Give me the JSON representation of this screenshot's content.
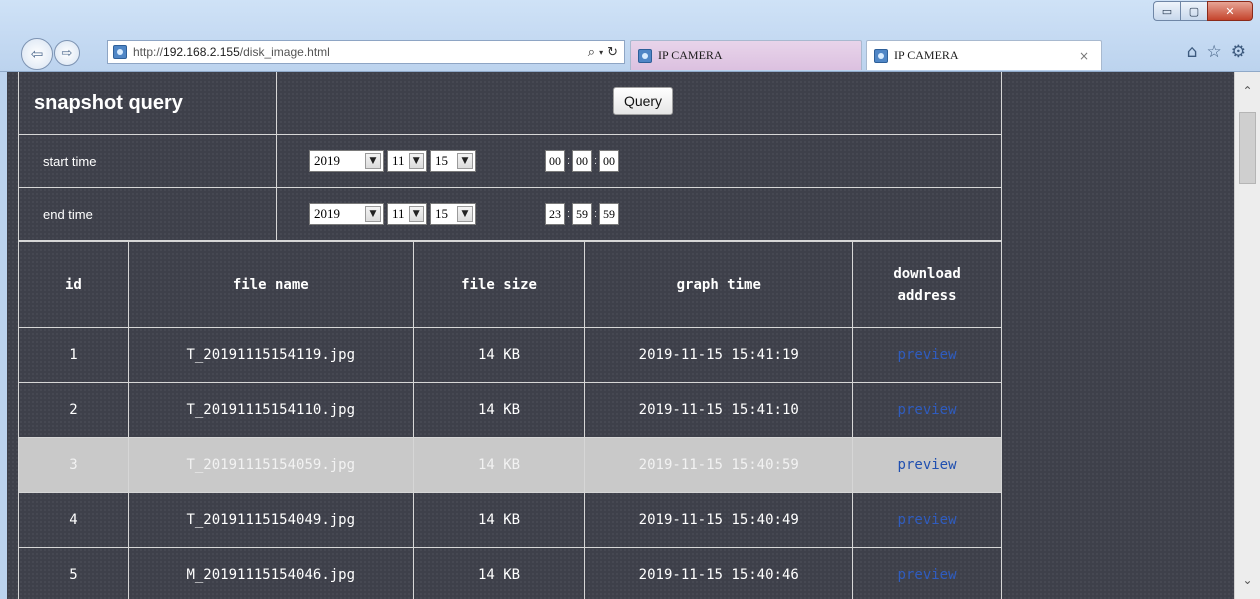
{
  "browser": {
    "url_prefix": "http://",
    "url_host": "192.168.2.155",
    "url_path": "/disk_image.html",
    "search_glyph": "⌕",
    "drop_glyph": "▾",
    "refresh_glyph": "↻",
    "back_glyph": "⇦",
    "forward_glyph": "⇨",
    "tabs": [
      {
        "title": "IP CAMERA"
      },
      {
        "title": "IP CAMERA",
        "close": "×"
      }
    ],
    "icons": {
      "home": "⌂",
      "favorites": "☆",
      "settings": "⚙"
    },
    "window_controls": {
      "minimize": "▭",
      "maximize": "▢",
      "close": "✕"
    }
  },
  "query": {
    "title": "snapshot query",
    "button_label": "Query",
    "start": {
      "label": "start time",
      "year": "2019",
      "month": "11",
      "day": "15",
      "hh": "00",
      "mm": "00",
      "ss": "00"
    },
    "end": {
      "label": "end time",
      "year": "2019",
      "month": "11",
      "day": "15",
      "hh": "23",
      "mm": "59",
      "ss": "59"
    },
    "dropdown_glyph": "▼",
    "time_separator": ":"
  },
  "table": {
    "headers": {
      "id": "id",
      "file_name": "file name",
      "file_size": "file size",
      "graph_time": "graph time",
      "download_line1": "download",
      "download_line2": "address"
    },
    "rows": [
      {
        "id": "1",
        "file_name": "T_20191115154119.jpg",
        "file_size": "14 KB",
        "graph_time": "2019-11-15 15:41:19",
        "link": "preview"
      },
      {
        "id": "2",
        "file_name": "T_20191115154110.jpg",
        "file_size": "14 KB",
        "graph_time": "2019-11-15 15:41:10",
        "link": "preview"
      },
      {
        "id": "3",
        "file_name": "T_20191115154059.jpg",
        "file_size": "14 KB",
        "graph_time": "2019-11-15 15:40:59",
        "link": "preview"
      },
      {
        "id": "4",
        "file_name": "T_20191115154049.jpg",
        "file_size": "14 KB",
        "graph_time": "2019-11-15 15:40:49",
        "link": "preview"
      },
      {
        "id": "5",
        "file_name": "M_20191115154046.jpg",
        "file_size": "14 KB",
        "graph_time": "2019-11-15 15:40:46",
        "link": "preview"
      }
    ]
  },
  "colors": {
    "page_background": "#3e404a",
    "border": "#d6d6d6",
    "highlight_row": "#c9c9c9",
    "link": "#2f5cbf"
  }
}
